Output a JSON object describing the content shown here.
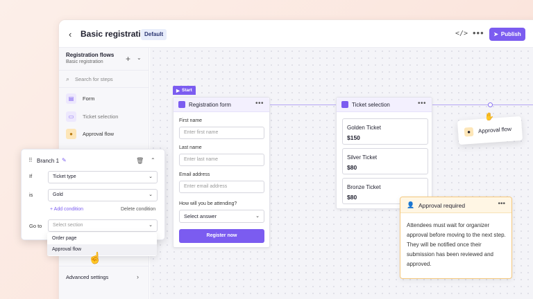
{
  "header": {
    "back_icon": "chevron-left-icon",
    "title": "Basic registration",
    "badge": "Default",
    "code_icon": "</>",
    "more_icon": "•••",
    "publish_label": "Publish"
  },
  "sidebar": {
    "title": "Registration flows",
    "subtitle": "Basic registration",
    "search_placeholder": "Search for steps",
    "items": [
      {
        "label": "Form",
        "icon": "form-icon",
        "color": "#ede8fd"
      },
      {
        "label": "Ticket selection",
        "icon": "ticket-icon",
        "color": "#ede8fd"
      },
      {
        "label": "Approval flow",
        "icon": "approval-icon",
        "color": "#fde6b8"
      }
    ],
    "advanced_label": "Advanced settings"
  },
  "canvas": {
    "start_label": "Start",
    "registration_form": {
      "title": "Registration form",
      "fields": [
        {
          "label": "First name",
          "placeholder": "Enter first name"
        },
        {
          "label": "Last name",
          "placeholder": "Enter last name"
        },
        {
          "label": "Email address",
          "placeholder": "Enter email address"
        }
      ],
      "attending_label": "How will you be attending?",
      "attending_value": "Select answer",
      "register_label": "Register now"
    },
    "ticket_selection": {
      "title": "Ticket selection",
      "tickets": [
        {
          "name": "Golden Ticket",
          "price": "$150"
        },
        {
          "name": "Silver Ticket",
          "price": "$80"
        },
        {
          "name": "Bronze Ticket",
          "price": "$80"
        }
      ]
    },
    "floating_chip": {
      "label": "Approval flow"
    },
    "approval": {
      "title": "Approval required",
      "body": "Attendees must wait for organizer approval before moving to the next step. They will be notified once their submission has been reviewed and approved."
    }
  },
  "branch": {
    "title": "Branch 1",
    "if_label": "If",
    "if_value": "Ticket type",
    "is_label": "is",
    "is_value": "Gold",
    "add_condition": "+ Add condition",
    "delete_condition": "Delete condition",
    "goto_label": "Go to",
    "goto_placeholder": "Select section",
    "options": [
      "Order page",
      "Approval flow"
    ]
  },
  "colors": {
    "accent": "#7b5cf0",
    "approval_border": "#f5c77b"
  }
}
